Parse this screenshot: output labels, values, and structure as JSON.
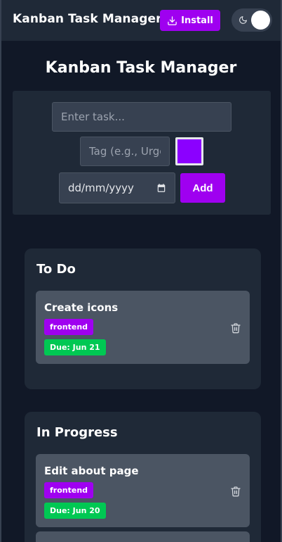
{
  "header": {
    "app_title": "Kanban Task Manager",
    "install_label": "Install",
    "theme_toggle_icon": "moon-icon"
  },
  "page": {
    "title": "Kanban Task Manager"
  },
  "form": {
    "task_placeholder": "Enter task...",
    "tag_placeholder": "Tag (e.g., Urgent)",
    "tag_color": "#8b00ff",
    "date_value": "dd/mm/yyyy",
    "add_label": "Add"
  },
  "columns": [
    {
      "title": "To Do",
      "cards": [
        {
          "title": "Create icons",
          "tag": "frontend",
          "tag_color": "#9f00f0",
          "due": "Due: Jun 21"
        }
      ]
    },
    {
      "title": "In Progress",
      "cards": [
        {
          "title": "Edit about page",
          "tag": "frontend",
          "tag_color": "#9f00f0",
          "due": "Due: Jun 20"
        }
      ]
    }
  ],
  "colors": {
    "background": "#111827",
    "surface": "#1f2937",
    "card": "#4b5563",
    "accent": "#9f00f0",
    "due_green": "#00c853"
  }
}
